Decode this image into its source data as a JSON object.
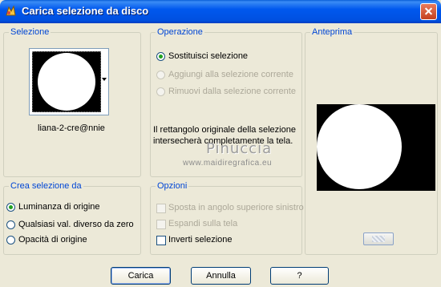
{
  "window": {
    "title": "Carica selezione da disco"
  },
  "selezione": {
    "legend": "Selezione",
    "file_name": "liana-2-cre@nnie"
  },
  "operazione": {
    "legend": "Operazione",
    "options": [
      {
        "label": "Sostituisci selezione",
        "checked": true,
        "enabled": true
      },
      {
        "label": "Aggiungi alla selezione corrente",
        "checked": false,
        "enabled": false
      },
      {
        "label": "Rimuovi dalla selezione corrente",
        "checked": false,
        "enabled": false
      }
    ],
    "info_line1": "Il rettangolo originale della selezione",
    "info_line2": "intersecherà completamente la tela."
  },
  "anteprima": {
    "legend": "Anteprima"
  },
  "crea": {
    "legend": "Crea selezione da",
    "options": [
      {
        "label": "Luminanza di origine",
        "checked": true
      },
      {
        "label": "Qualsiasi val. diverso da zero",
        "checked": false
      },
      {
        "label": "Opacità di origine",
        "checked": false
      }
    ]
  },
  "opzioni": {
    "legend": "Opzioni",
    "items": [
      {
        "label": "Sposta in angolo superiore sinistro",
        "checked": false,
        "enabled": false
      },
      {
        "label": "Espandi sulla tela",
        "checked": false,
        "enabled": false
      },
      {
        "label": "Inverti selezione",
        "checked": false,
        "enabled": true
      }
    ]
  },
  "watermark": {
    "line1": "Pinuccia",
    "line2": "www.maidiregrafica.eu"
  },
  "buttons": {
    "load": "Carica",
    "cancel": "Annulla",
    "help": "?"
  },
  "icons": {
    "app": "psp-app-icon",
    "close": "close-icon",
    "dropdown": "chevron-down-icon"
  }
}
